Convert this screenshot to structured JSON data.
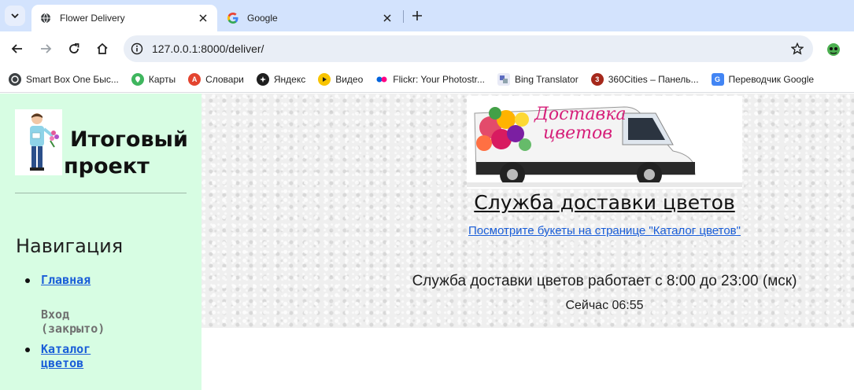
{
  "browser": {
    "tabs": [
      {
        "title": "Flower Delivery",
        "active": true
      },
      {
        "title": "Google",
        "active": false
      }
    ],
    "address_bar": {
      "url": "127.0.0.1:8000/deliver/"
    },
    "bookmarks": [
      {
        "label": "Smart Box One Быс...",
        "icon": "smartbox-icon"
      },
      {
        "label": "Карты",
        "icon": "maps-icon"
      },
      {
        "label": "Словари",
        "icon": "dictionaries-icon"
      },
      {
        "label": "Яндекс",
        "icon": "yandex-icon"
      },
      {
        "label": "Видео",
        "icon": "video-icon"
      },
      {
        "label": "Flickr: Your Photostr...",
        "icon": "flickr-icon"
      },
      {
        "label": "Bing Translator",
        "icon": "bing-translator-icon"
      },
      {
        "label": "360Cities – Панель...",
        "icon": "360cities-icon"
      },
      {
        "label": "Переводчик Google",
        "icon": "google-translate-icon"
      }
    ]
  },
  "sidebar": {
    "brand_line1": "Итоговый",
    "brand_line2": "проект",
    "nav_heading": "Навигация",
    "nav_items": [
      {
        "label": "Главная",
        "enabled": true
      },
      {
        "label": "Вход (закрыто)",
        "enabled": false
      },
      {
        "label": "Каталог цветов",
        "enabled": true
      }
    ]
  },
  "main": {
    "van_banner_text": "Доставка цветов",
    "headline": "Служба доставки цветов",
    "catalog_link": "Посмотрите букеты на странице \"Каталог цветов\"",
    "hours": "Служба доставки цветов работает с 8:00 до 23:00 (мск)",
    "now": "Сейчас 06:55"
  },
  "colors": {
    "tabstrip": "#d3e3fd",
    "sidebar": "#d7fde3",
    "link": "#1a5ed8",
    "banner_pink": "#d6207a"
  }
}
